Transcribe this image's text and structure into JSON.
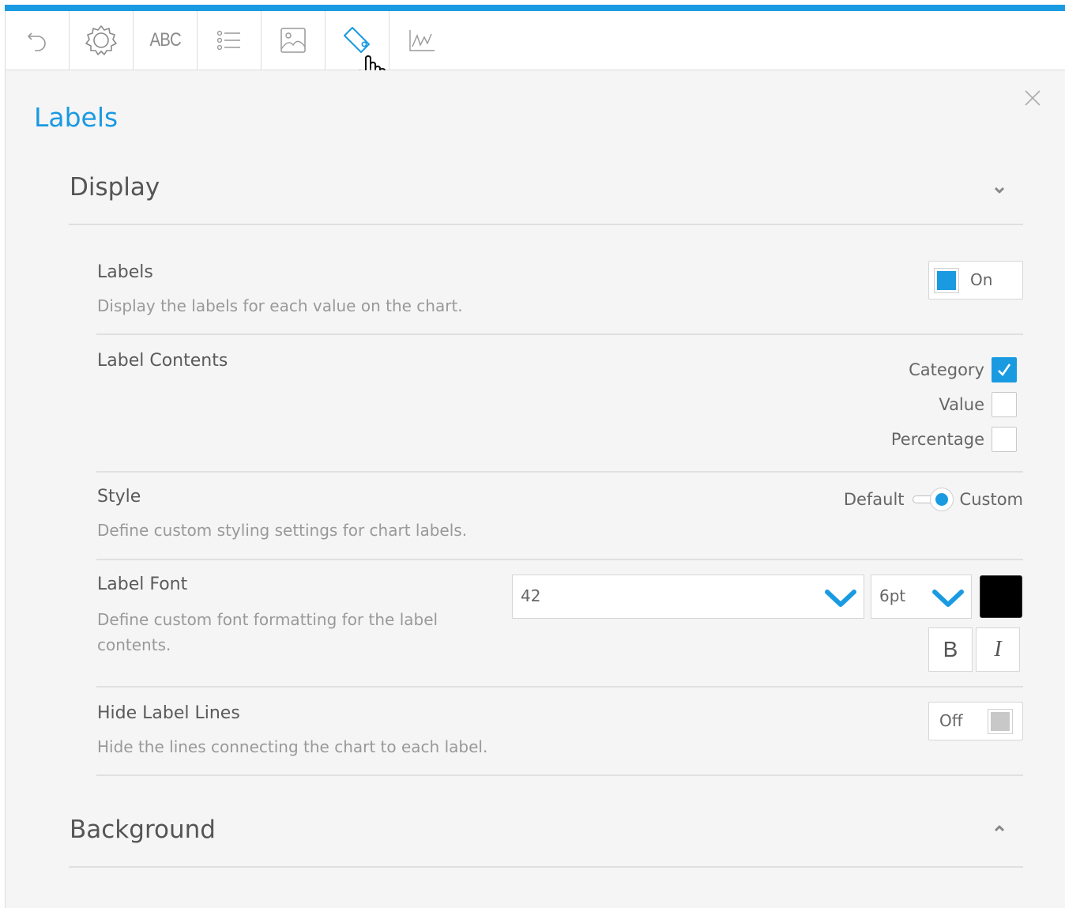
{
  "toolbar": {
    "tools": [
      {
        "name": "undo",
        "icon": "undo-icon"
      },
      {
        "name": "settings",
        "icon": "gear-icon"
      },
      {
        "name": "text",
        "label": "ABC"
      },
      {
        "name": "list",
        "icon": "list-icon"
      },
      {
        "name": "image",
        "icon": "image-icon"
      },
      {
        "name": "labels",
        "icon": "tag-icon",
        "active": true
      },
      {
        "name": "chart",
        "icon": "line-chart-icon"
      }
    ],
    "accent_color": "#1a9ae1"
  },
  "panel": {
    "title": "Labels",
    "sections": {
      "display": {
        "title": "Display",
        "expanded": true
      },
      "background": {
        "title": "Background",
        "expanded": false
      }
    },
    "rows": {
      "labels": {
        "title": "Labels",
        "description": "Display the labels for each value on the chart.",
        "toggle_label": "On",
        "toggle_state": true
      },
      "label_contents": {
        "title": "Label Contents",
        "options": [
          {
            "label": "Category",
            "checked": true
          },
          {
            "label": "Value",
            "checked": false
          },
          {
            "label": "Percentage",
            "checked": false
          }
        ]
      },
      "style": {
        "title": "Style",
        "description": "Define custom styling settings for chart labels.",
        "left_option": "Default",
        "right_option": "Custom",
        "selected": "Custom"
      },
      "label_font": {
        "title": "Label Font",
        "description": "Define custom font formatting for the label contents.",
        "font_value": "42",
        "size_value": "6pt",
        "color": "#000000",
        "bold_label": "B",
        "italic_label": "I"
      },
      "hide_label_lines": {
        "title": "Hide Label Lines",
        "description": "Hide the lines connecting the chart to each label.",
        "toggle_label": "Off",
        "toggle_state": false
      }
    }
  }
}
